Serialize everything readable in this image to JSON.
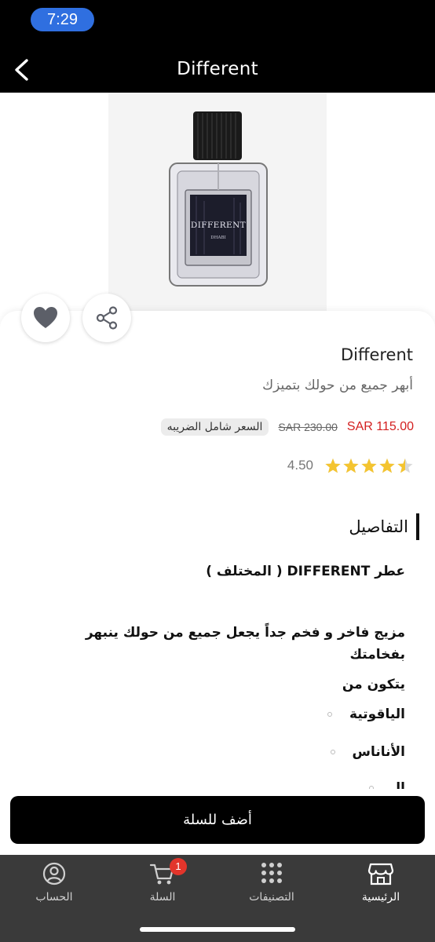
{
  "status_bar": {
    "time": "7:29"
  },
  "header": {
    "title": "Different",
    "back_icon": "chevron-left-icon"
  },
  "product": {
    "image_alt": "Different perfume bottle",
    "bottle_label_main": "DIFFERENT",
    "bottle_label_sub": "DHABI",
    "name": "Different",
    "subtitle": "أبهر جميع من حولك بتميزك",
    "price_new": "SAR 115.00",
    "price_old": "SAR 230.00",
    "tax_note": "السعر شامل الضريبه",
    "rating": 4.5,
    "rating_text": "4.50",
    "stars_total": 5
  },
  "actions": {
    "favorite_icon": "heart-icon",
    "share_icon": "share-icon"
  },
  "details": {
    "title": "التفاصيل",
    "line1": "عطر DIFFERENT ( المختلف )",
    "line2": "مزيج فاخر و فخم جداً يجعل جميع من حولك ينبهر بفخامتك",
    "line3": "يتكون من",
    "ingredients": [
      "الياقوتية",
      "الأناناس",
      "الـ"
    ]
  },
  "cart_button": {
    "label": "أضف للسلة"
  },
  "bottom_nav": {
    "items": [
      {
        "label": "الرئيسية",
        "icon": "store-icon",
        "active": true
      },
      {
        "label": "التصنيفات",
        "icon": "grid-icon",
        "active": false
      },
      {
        "label": "السلة",
        "icon": "cart-icon",
        "active": false,
        "badge": "1"
      },
      {
        "label": "الحساب",
        "icon": "user-icon",
        "active": false
      }
    ]
  },
  "colors": {
    "accent": "#000000",
    "price": "#d32020",
    "star": "#f4c430",
    "badge": "#e2352b",
    "nav_bg": "#3a3a3a"
  }
}
